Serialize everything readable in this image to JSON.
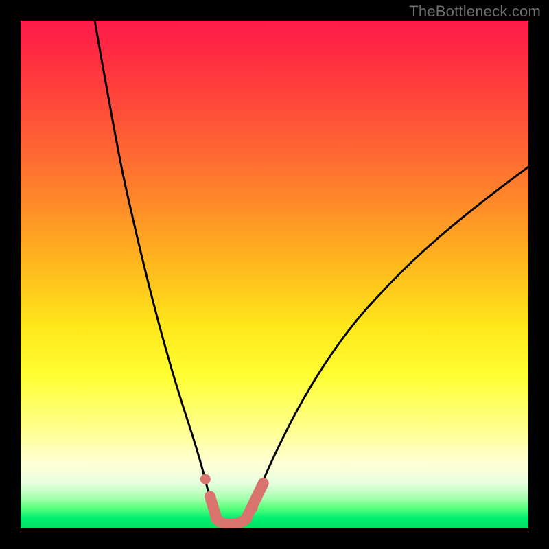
{
  "watermark": {
    "text": "TheBottleneck.com"
  },
  "colors": {
    "curve_stroke": "#000000",
    "coral": "#d9736e",
    "background_black": "#000000"
  },
  "chart_data": {
    "type": "line",
    "title": "",
    "xlabel": "",
    "ylabel": "",
    "xlim": [
      0,
      100
    ],
    "ylim": [
      0,
      100
    ],
    "grid": false,
    "legend": false,
    "series": [
      {
        "name": "left-branch",
        "x": [
          14.6,
          16,
          18,
          20,
          22,
          24,
          26,
          28,
          30,
          32,
          34,
          35.5,
          36.5,
          37.5,
          38.5
        ],
        "values": [
          100,
          92,
          81,
          70.5,
          61.5,
          53,
          45,
          37.5,
          30.5,
          24,
          17.8,
          12.8,
          9.0,
          5.2,
          2.0
        ]
      },
      {
        "name": "right-branch",
        "x": [
          44.5,
          46,
          48,
          50,
          53,
          56,
          60,
          65,
          70,
          76,
          82,
          88,
          94,
          100
        ],
        "values": [
          2.0,
          5.5,
          10.0,
          14.4,
          20.5,
          26.0,
          32.5,
          39.5,
          45.3,
          51.5,
          57.0,
          62.0,
          66.7,
          71.2
        ]
      },
      {
        "name": "coral-floor",
        "x": [
          38.5,
          39.4,
          40.5,
          42.0,
          43.4,
          44.5
        ],
        "values": [
          2.0,
          1.2,
          0.9,
          0.9,
          1.2,
          2.0
        ]
      }
    ],
    "markers": [
      {
        "name": "coral-dot-left",
        "x": 36.4,
        "y": 9.7
      },
      {
        "name": "coral-dot-right-1",
        "x": 45.7,
        "y": 4.1
      },
      {
        "name": "coral-dot-right-2",
        "x": 46.5,
        "y": 6.0
      },
      {
        "name": "coral-dot-right-3",
        "x": 47.5,
        "y": 8.2
      }
    ]
  }
}
